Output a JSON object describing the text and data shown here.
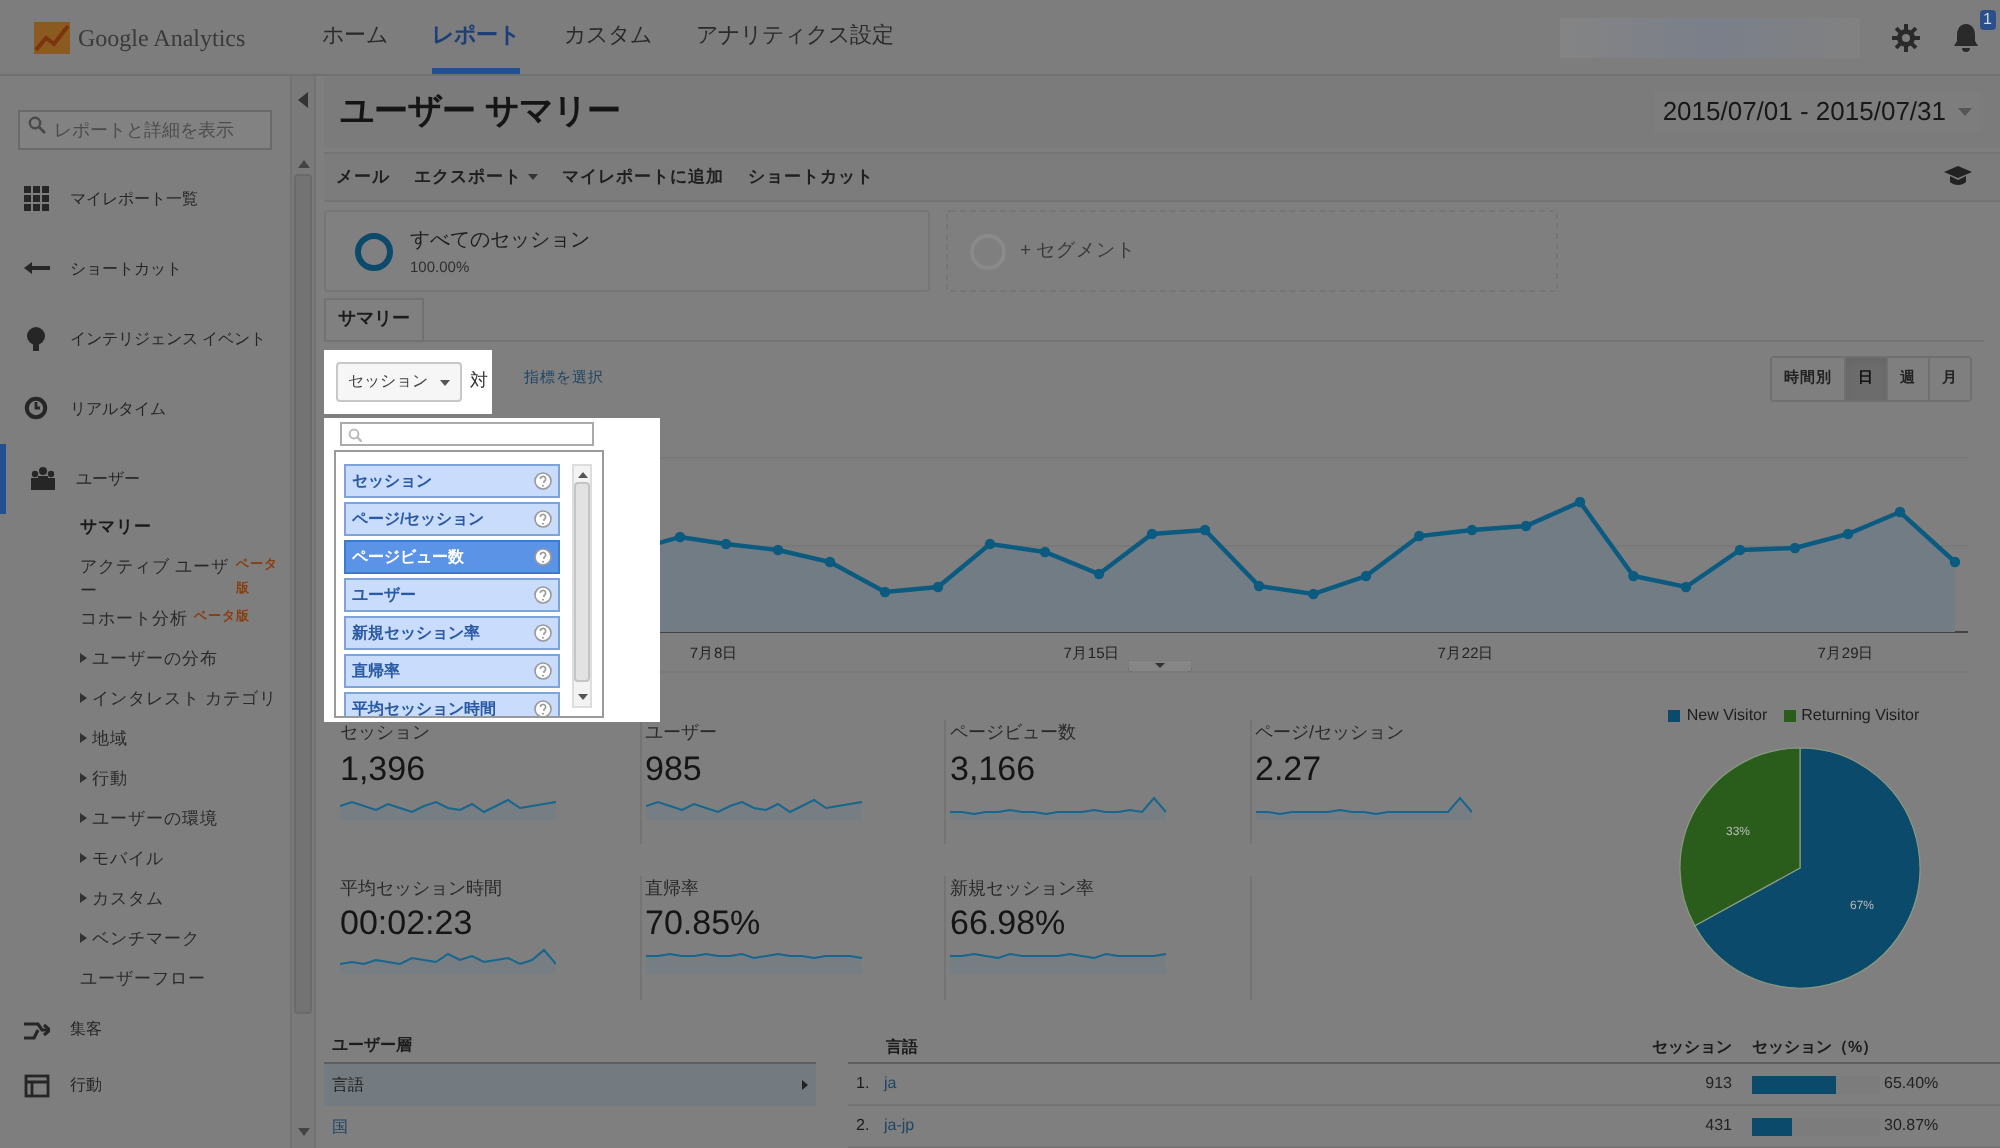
{
  "header": {
    "logo": "Google Analytics",
    "nav": [
      {
        "label": "ホーム",
        "selected": false
      },
      {
        "label": "レポート",
        "selected": true
      },
      {
        "label": "カスタム",
        "selected": false
      },
      {
        "label": "アナリティクス設定",
        "selected": false
      }
    ],
    "notification_count": "1"
  },
  "sidebar": {
    "search_placeholder": "レポートと詳細を表示",
    "items": [
      {
        "label": "マイレポート一覧",
        "selected": false
      },
      {
        "label": "ショートカット",
        "selected": false
      },
      {
        "label": "インテリジェンス イベント",
        "selected": false
      },
      {
        "label": "リアルタイム",
        "selected": false
      },
      {
        "label": "ユーザー",
        "selected": true,
        "children": [
          {
            "label": "サマリー",
            "selected": true,
            "expandable": false
          },
          {
            "label": "アクティブ ユーザー",
            "badge": "ベータ版",
            "selected": false,
            "expandable": false
          },
          {
            "label": "コホート分析",
            "badge": "ベータ版",
            "selected": false,
            "expandable": false
          },
          {
            "label": "ユーザーの分布",
            "selected": false,
            "expandable": true
          },
          {
            "label": "インタレスト カテゴリ",
            "selected": false,
            "expandable": true
          },
          {
            "label": "地域",
            "selected": false,
            "expandable": true
          },
          {
            "label": "行動",
            "selected": false,
            "expandable": true
          },
          {
            "label": "ユーザーの環境",
            "selected": false,
            "expandable": true
          },
          {
            "label": "モバイル",
            "selected": false,
            "expandable": true
          },
          {
            "label": "カスタム",
            "selected": false,
            "expandable": true
          },
          {
            "label": "ベンチマーク",
            "selected": false,
            "expandable": true
          },
          {
            "label": "ユーザーフロー",
            "selected": false,
            "expandable": false
          }
        ]
      },
      {
        "label": "集客",
        "selected": false
      },
      {
        "label": "行動",
        "selected": false
      }
    ]
  },
  "report": {
    "title": "ユーザー サマリー",
    "date_range": "2015/07/01 - 2015/07/31",
    "toolbar": [
      {
        "label": "メール",
        "dropdown": false
      },
      {
        "label": "エクスポート",
        "dropdown": true
      },
      {
        "label": "マイレポートに追加",
        "dropdown": false
      },
      {
        "label": "ショートカット",
        "dropdown": false
      }
    ],
    "segments": [
      {
        "kind": "active",
        "label": "すべてのセッション",
        "value": "100.00%"
      },
      {
        "kind": "add",
        "label": "+ セグメント"
      }
    ],
    "tabs": [
      {
        "label": "サマリー",
        "selected": true
      }
    ],
    "metric_picker": {
      "value": "セッション",
      "versus": "対",
      "select_link": "指標を選択",
      "options": [
        {
          "label": "セッション",
          "highlighted": false
        },
        {
          "label": "ページ/セッション",
          "highlighted": false
        },
        {
          "label": "ページビュー数",
          "highlighted": true
        },
        {
          "label": "ユーザー",
          "highlighted": false
        },
        {
          "label": "新規セッション率",
          "highlighted": false
        },
        {
          "label": "直帰率",
          "highlighted": false
        },
        {
          "label": "平均セッション時間",
          "highlighted": false
        }
      ]
    },
    "granularity": [
      {
        "label": "時間別",
        "selected": false
      },
      {
        "label": "日",
        "selected": true
      },
      {
        "label": "週",
        "selected": false
      },
      {
        "label": "月",
        "selected": false
      }
    ],
    "line_chart": {
      "x_labels": [
        "7月8日",
        "7月15日",
        "7月22日",
        "7月29日"
      ]
    },
    "metrics": [
      {
        "label": "セッション",
        "value": "1,396"
      },
      {
        "label": "ユーザー",
        "value": "985"
      },
      {
        "label": "ページビュー数",
        "value": "3,166"
      },
      {
        "label": "ページ/セッション",
        "value": "2.27"
      },
      {
        "label": "平均セッション時間",
        "value": "00:02:23"
      },
      {
        "label": "直帰率",
        "value": "70.85%"
      },
      {
        "label": "新規セッション率",
        "value": "66.98%"
      }
    ],
    "visitor_chart": {
      "chart_data": {
        "type": "pie",
        "legend": "top",
        "categories": [
          "New Visitor",
          "Returning Visitor"
        ],
        "series": [
          {
            "values": [
              67,
              33
            ]
          }
        ],
        "value_labels": [
          "67%",
          "33%"
        ]
      }
    },
    "demographics": {
      "title": "ユーザー層",
      "items": [
        {
          "label": "言語",
          "selected": true
        },
        {
          "label": "国",
          "selected": false
        }
      ]
    },
    "language_table": {
      "columns": [
        "言語",
        "セッション",
        "セッション（%）"
      ],
      "rows": [
        {
          "rank": "1.",
          "language": "ja",
          "sessions": "913",
          "share": "65.40%",
          "level": 0.654
        },
        {
          "rank": "2.",
          "language": "ja-jp",
          "sessions": "431",
          "share": "30.87%",
          "level": 0.3087
        }
      ]
    }
  }
}
